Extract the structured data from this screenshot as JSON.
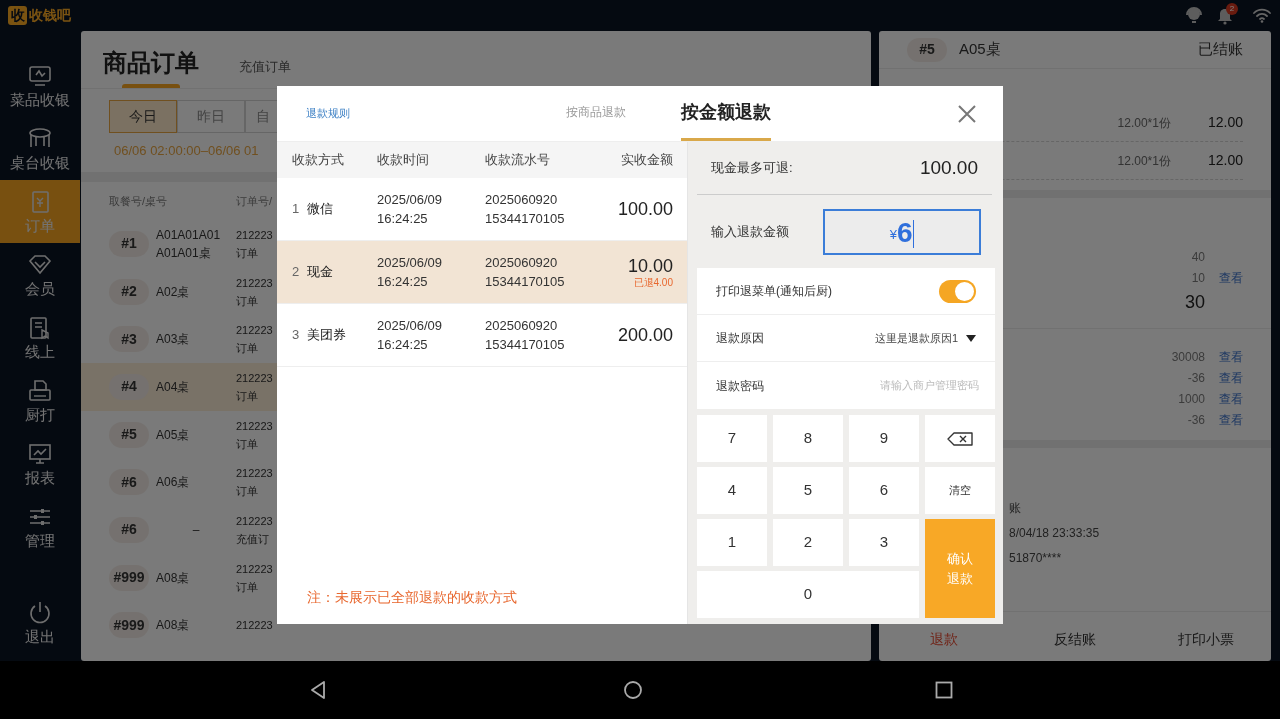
{
  "status_bar": {
    "logo_char": "收",
    "app_name": "收钱吧",
    "notification_count": "2"
  },
  "sidebar": {
    "items": [
      {
        "label": "菜品收银",
        "selected": false
      },
      {
        "label": "桌台收银",
        "selected": false
      },
      {
        "label": "订单",
        "selected": true
      },
      {
        "label": "会员",
        "selected": false
      },
      {
        "label": "线上",
        "selected": false
      },
      {
        "label": "厨打",
        "selected": false
      },
      {
        "label": "报表",
        "selected": false
      },
      {
        "label": "管理",
        "selected": false
      }
    ],
    "logout": "退出"
  },
  "orders_panel": {
    "tabs": [
      {
        "label": "商品订单",
        "selected": true
      },
      {
        "label": "充值订单",
        "selected": false
      }
    ],
    "date_tabs": [
      {
        "label": "今日",
        "selected": true
      },
      {
        "label": "昨日",
        "selected": false
      },
      {
        "label": "自",
        "selected": false
      }
    ],
    "date_range": "06/06 02:00:00–06/06 01",
    "columns": [
      "取餐号/桌号",
      "订单号/"
    ],
    "rows": [
      {
        "pickup_no": "#1",
        "table": "A01A01A01 A01A01桌",
        "order_no": "212223",
        "order_type": "订单",
        "selected": false
      },
      {
        "pickup_no": "#2",
        "table": "A02桌",
        "order_no": "212223",
        "order_type": "订单",
        "selected": false
      },
      {
        "pickup_no": "#3",
        "table": "A03桌",
        "order_no": "212223",
        "order_type": "订单",
        "selected": false
      },
      {
        "pickup_no": "#4",
        "table": "A04桌",
        "order_no": "212223",
        "order_type": "订单",
        "selected": true
      },
      {
        "pickup_no": "#5",
        "table": "A05桌",
        "order_no": "212223",
        "order_type": "订单",
        "selected": false
      },
      {
        "pickup_no": "#6",
        "table": "A06桌",
        "order_no": "212223",
        "order_type": "订单",
        "selected": false
      },
      {
        "pickup_no": "#6",
        "table": "–",
        "order_no": "212223",
        "order_type": "充值订",
        "selected": false
      },
      {
        "pickup_no": "#999",
        "table": "A08桌",
        "order_no": "212223",
        "order_type": "订单",
        "selected": false
      },
      {
        "pickup_no": "#999",
        "table": "A08桌",
        "order_no": "212223",
        "selected": false
      }
    ]
  },
  "order_detail": {
    "pickup_no": "#5",
    "table": "A05桌",
    "status": "已结账",
    "items": [
      {
        "qty_price": "12.00*1份",
        "amount": "12.00"
      },
      {
        "qty_price": "12.00*1份",
        "amount": "12.00"
      }
    ],
    "summary": [
      {
        "value": "40",
        "kind": "plain"
      },
      {
        "value": "10",
        "link": "查看",
        "kind": "plain"
      },
      {
        "value": "30",
        "kind": "total"
      }
    ],
    "payments": [
      {
        "value": "30008",
        "link": "查看"
      },
      {
        "value": "-36",
        "link": "查看"
      },
      {
        "value": "1000",
        "link": "查看"
      },
      {
        "value": "-36",
        "link": "查看"
      }
    ],
    "info": [
      "账",
      "8/04/18 23:33:35",
      "51870****"
    ],
    "actions": [
      {
        "label": "退款",
        "kind": "danger"
      },
      {
        "label": "反结账",
        "kind": "normal"
      },
      {
        "label": "打印小票",
        "kind": "normal"
      }
    ]
  },
  "refund_dialog": {
    "rules_link": "退款规则",
    "tabs": [
      {
        "label": "按商品退款",
        "selected": false
      },
      {
        "label": "按金额退款",
        "selected": true
      }
    ],
    "columns": [
      "收款方式",
      "收款时间",
      "收款流水号",
      "实收金额"
    ],
    "rows": [
      {
        "index": "1",
        "method": "微信",
        "date": "2025/06/09",
        "time": "16:24:25",
        "serial": [
          "2025060920",
          "15344170105"
        ],
        "amount": "100.00",
        "selected": false
      },
      {
        "index": "2",
        "method": "现金",
        "date": "2025/06/09",
        "time": "16:24:25",
        "serial": [
          "2025060920",
          "15344170105"
        ],
        "amount": "10.00",
        "refunded": "已退4.00",
        "selected": true
      },
      {
        "index": "3",
        "method": "美团券",
        "date": "2025/06/09",
        "time": "16:24:25",
        "serial": [
          "2025060920",
          "15344170105"
        ],
        "amount": "200.00",
        "selected": false
      }
    ],
    "note": "注：未展示已全部退款的收款方式",
    "max_refund": {
      "label": "现金最多可退:",
      "value": "100.00"
    },
    "amount_input": {
      "label": "输入退款金额",
      "currency": "¥",
      "value": "6"
    },
    "print_toggle": {
      "label": "打印退菜单(通知后厨)",
      "on": true
    },
    "reason": {
      "label": "退款原因",
      "value": "这里是退款原因1"
    },
    "password": {
      "label": "退款密码",
      "placeholder": "请输入商户管理密码"
    },
    "keypad": [
      {
        "label": "7",
        "kind": "digit"
      },
      {
        "label": "8",
        "kind": "digit"
      },
      {
        "label": "9",
        "kind": "digit"
      },
      {
        "kind": "backspace"
      },
      {
        "label": "4",
        "kind": "digit"
      },
      {
        "label": "5",
        "kind": "digit"
      },
      {
        "label": "6",
        "kind": "digit"
      },
      {
        "label": "清空",
        "kind": "clear"
      },
      {
        "label": "1",
        "kind": "digit"
      },
      {
        "label": "2",
        "kind": "digit"
      },
      {
        "label": "3",
        "kind": "digit"
      },
      {
        "label": "确认退款",
        "kind": "confirm"
      },
      {
        "label": "0",
        "kind": "zero"
      }
    ]
  }
}
